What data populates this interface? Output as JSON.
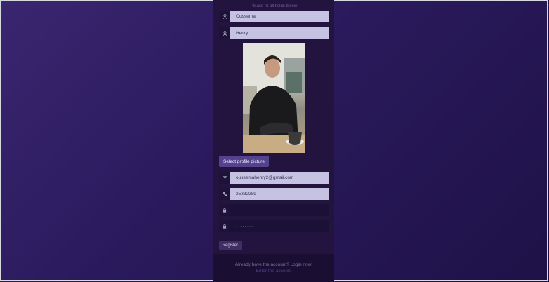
{
  "form": {
    "hint": "Please fill all fields below",
    "first_name": {
      "icon": "user-icon",
      "value": "Oussema"
    },
    "last_name": {
      "icon": "user-icon",
      "value": "Henry"
    },
    "select_picture_label": "Select profile picture",
    "email": {
      "icon": "envelope-icon",
      "value": "oussemahenry2@gmail.com"
    },
    "phone": {
      "icon": "phone-icon",
      "value": "25382289"
    },
    "password": {
      "icon": "lock-icon",
      "value": "········"
    },
    "confirm_password": {
      "icon": "lock-icon",
      "value": "········"
    },
    "register_label": "Register"
  },
  "footer": {
    "text": "Already have the account? Login now!",
    "link": "Enter the account"
  },
  "colors": {
    "accent": "#54428f",
    "panel": "#22143f",
    "field_light": "#c6c3e2"
  }
}
